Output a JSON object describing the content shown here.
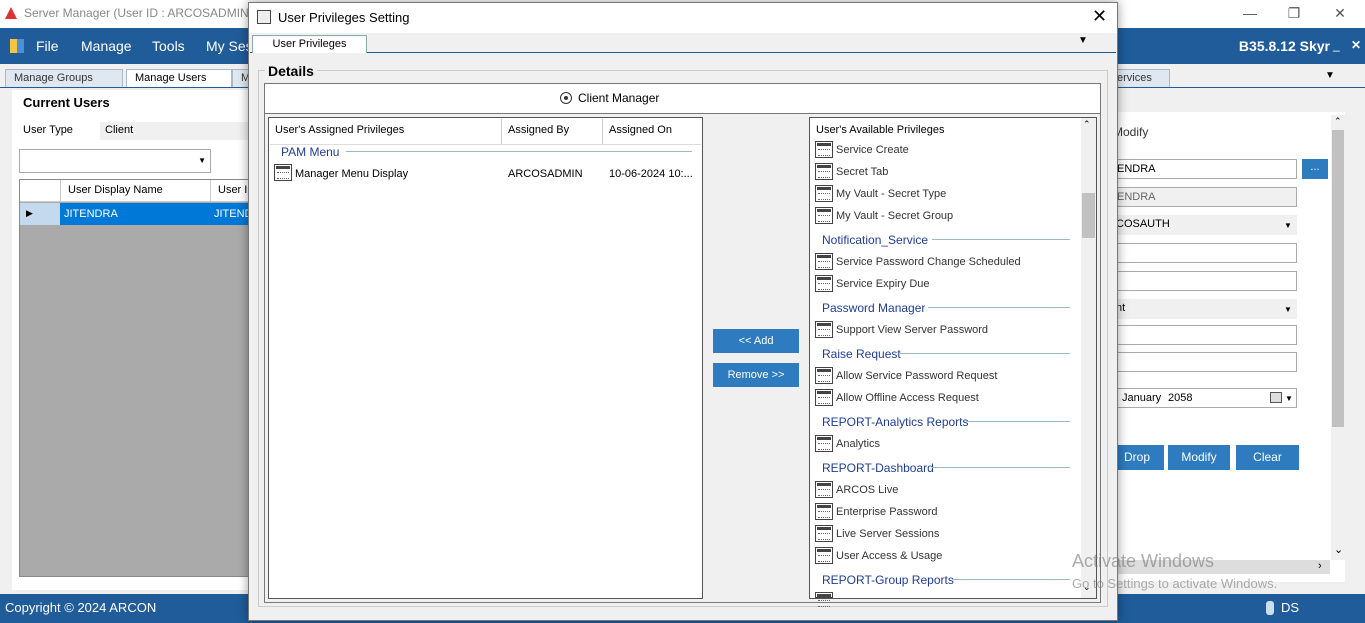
{
  "main_window": {
    "title": "Server Manager (User ID : ARCOSADMIN Lo",
    "menu": [
      "File",
      "Manage",
      "Tools",
      "My Ses"
    ],
    "version": "B35.8.12 Skyr",
    "tabs": [
      "Manage Groups",
      "Manage Users",
      "M",
      "ervices"
    ],
    "current_users_title": "Current Users",
    "user_type_label": "User Type",
    "user_type_value": "Client",
    "grid": {
      "headers": [
        "User Display Name",
        "User I"
      ],
      "row": [
        "JITENDRA",
        "JITEND"
      ]
    },
    "right_panel": {
      "modify_label": "Modify",
      "field1": "ENDRA",
      "field2": "ENDRA",
      "field3": "COSAUTH",
      "field6": "nt",
      "date_month": "January",
      "date_year": "2058",
      "drop_label": "Drop",
      "modify_btn": "Modify",
      "clear_btn": "Clear",
      "dots": "..."
    },
    "status": {
      "copyright": "Copyright © 2024 ARCON",
      "ds": "DS"
    },
    "watermark": {
      "line1": "Activate Windows",
      "line2": "Go to Settings to activate Windows."
    }
  },
  "dialog": {
    "title": "User Privileges Setting",
    "tab": "User Privileges",
    "details_title": "Details",
    "client_label": "Client Manager",
    "assigned": {
      "headers": [
        "User's Assigned  Privileges",
        "Assigned By",
        "Assigned On"
      ],
      "group": "PAM Menu",
      "rows": [
        {
          "name": "Manager Menu Display",
          "by": "ARCOSADMIN",
          "on": "10-06-2024 10:..."
        }
      ]
    },
    "add_label": "<< Add",
    "remove_label": "Remove >>",
    "available": {
      "header": "User's Available Privileges",
      "groups": [
        {
          "title": "",
          "items": [
            "Service Create",
            "Secret Tab",
            "My Vault - Secret Type",
            "My Vault - Secret Group"
          ]
        },
        {
          "title": "Notification_Service",
          "items": [
            "Service Password Change Scheduled",
            "Service Expiry Due"
          ]
        },
        {
          "title": "Password Manager",
          "items": [
            "Support View Server Password"
          ]
        },
        {
          "title": "Raise Request",
          "items": [
            "Allow Service Password Request",
            "Allow Offline Access Request"
          ]
        },
        {
          "title": "REPORT-Analytics Reports",
          "items": [
            "Analytics"
          ]
        },
        {
          "title": "REPORT-Dashboard",
          "items": [
            "ARCOS Live",
            "Enterprise Password",
            "Live Server Sessions",
            "User Access & Usage"
          ]
        },
        {
          "title": "REPORT-Group Reports",
          "items": []
        }
      ]
    }
  }
}
